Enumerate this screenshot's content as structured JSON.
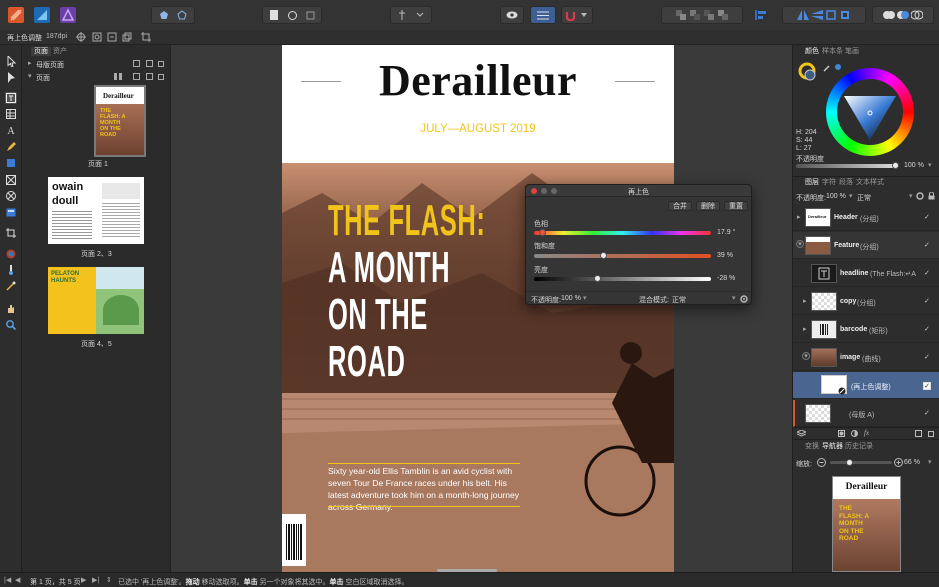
{
  "toolbar": {
    "persona_icons": [
      "publisher-persona-icon",
      "designer-persona-icon",
      "photo-persona-icon"
    ]
  },
  "context_bar": {
    "layer_label": "再上色调整",
    "dpi": "187dpi"
  },
  "pages_panel": {
    "tabs": [
      "页面",
      "资产"
    ],
    "master_label": "母版页面",
    "pages_label": "页面",
    "page1_label": "页面 1",
    "page23_label": "页面 2、3",
    "page45_label": "页面 4、5",
    "spread2_title_1": "owain",
    "spread2_title_2": "doull",
    "spread3_title": "PELATON HAUNTS"
  },
  "document": {
    "masthead": "Derailleur",
    "issue_date": "JULY—AUGUST 2019",
    "headline_1": "THE FLASH:",
    "headline_2": "A MONTH",
    "headline_3": "ON THE",
    "headline_4": "ROAD",
    "standfirst": "Sixty year-old Ellis Tamblin is an avid cyclist with seven Tour De France races under his belt. His latest adventure took him on a month-long journey across Germany."
  },
  "recolor_dialog": {
    "title": "再上色",
    "merge_label": "合并",
    "delete_label": "删除",
    "reset_label": "重置",
    "hue_label": "色相",
    "hue_value": "17.9 °",
    "hue_fraction": 0.05,
    "saturation_label": "饱和度",
    "saturation_value": "39 %",
    "saturation_fraction": 0.39,
    "lightness_label": "亮度",
    "lightness_value": "-28 %",
    "lightness_fraction": 0.36,
    "opacity_label": "不透明度:",
    "opacity_value": "100 %",
    "blend_label": "混合模式:",
    "blend_value": "正常"
  },
  "color_panel": {
    "tabs": [
      "颜色",
      "样本条",
      "笔画"
    ],
    "h": "H: 204",
    "s": "S: 44",
    "l": "L: 27",
    "opacity_label": "不透明度",
    "opacity_value": "100 %"
  },
  "layers_panel": {
    "tabs": [
      "图层",
      "字符",
      "段落",
      "文本样式"
    ],
    "opacity_label": "不透明度:",
    "opacity_value": "100 %",
    "blend_value": "正常",
    "layers": [
      {
        "name": "Header",
        "type": "(分组)"
      },
      {
        "name": "Feature",
        "type": "(分组)"
      },
      {
        "name": "headline",
        "type": "(The Flash:↵A M"
      },
      {
        "name": "copy",
        "type": "(分组)"
      },
      {
        "name": "barcode",
        "type": "(矩形)"
      },
      {
        "name": "image",
        "type": "(曲线)"
      },
      {
        "name": "",
        "type": "(再上色调整)"
      },
      {
        "name": "",
        "type": "(母版 A)"
      }
    ]
  },
  "navigator_panel": {
    "tabs": [
      "变换",
      "导航器",
      "历史记录"
    ],
    "zoom_label": "缩放:",
    "zoom_value": "66 %",
    "thumb_title": "Derailleur",
    "thumb_headline": "THE FLASH: A MONTH ON THE ROAD"
  },
  "status_bar": {
    "page_info": "第 1 页，共 5 页",
    "message_1": "已选中 '再上色调整'。",
    "bold_1": "拖动",
    "message_2": " 移动选取项。",
    "bold_2": "单击",
    "message_3": " 另一个对象将其选中。",
    "bold_3": "单击",
    "message_4": " 空白区域取消选择。"
  },
  "colors": {
    "accent": "#f0c419",
    "selection": "#4a6590",
    "sepia": "#8a5b42",
    "hue_knob": "#e8553a"
  }
}
